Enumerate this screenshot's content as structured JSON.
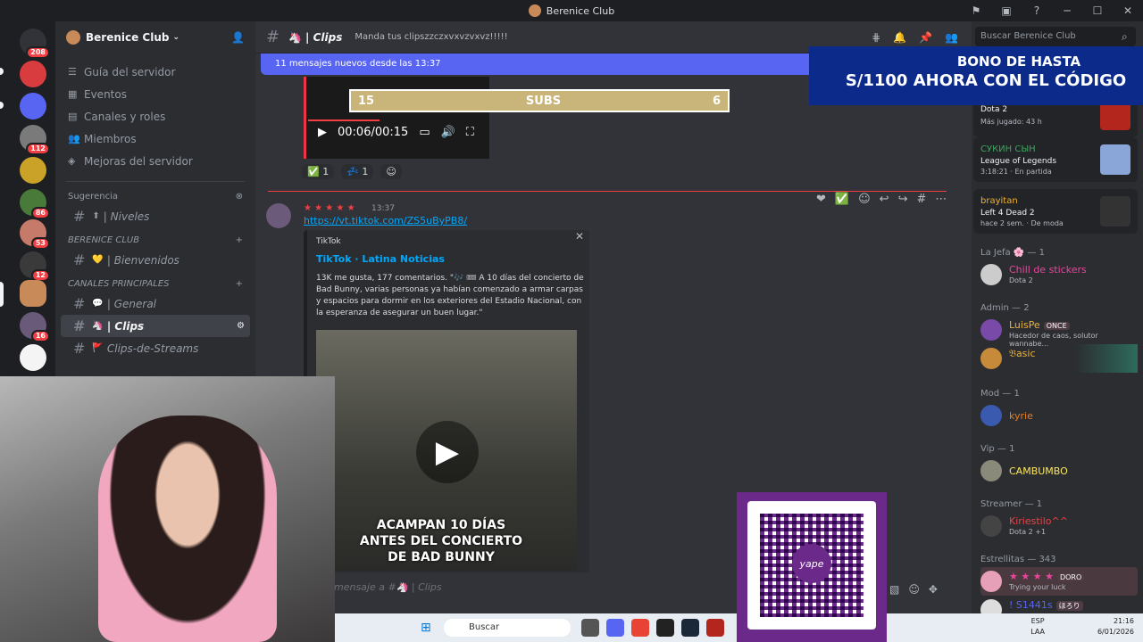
{
  "window": {
    "title": "Berenice Club"
  },
  "servers": {
    "badges": [
      "208",
      "112",
      "86",
      "53",
      "12",
      "16"
    ]
  },
  "sidebar": {
    "server_name": "Berenice Club",
    "nav": [
      {
        "icon": "list-icon",
        "label": "Guía del servidor"
      },
      {
        "icon": "calendar-icon",
        "label": "Eventos"
      },
      {
        "icon": "roles-icon",
        "label": "Canales y roles"
      },
      {
        "icon": "members-icon",
        "label": "Miembros"
      },
      {
        "icon": "boost-icon",
        "label": "Mejoras del servidor"
      }
    ],
    "suggestion_label": "Sugerencia",
    "suggestion_channel": "| Niveles",
    "cat1": "BERENICE CLUB",
    "cat1_channels": [
      "| Bienvenidos"
    ],
    "cat2": "CANALES PRINCIPALES",
    "cat2_channels": [
      "| General",
      "| Clips",
      "Clips-de-Streams"
    ]
  },
  "channel": {
    "name": "| Clips",
    "topic": "Manda tus clipszzczxvxvzvxvz!!!!!"
  },
  "banner": {
    "text": "11 mensajes nuevos desde las 13:37"
  },
  "video": {
    "time": "00:06/00:15",
    "overlay_left": "15",
    "overlay_mid": "SUBS",
    "overlay_right": "6"
  },
  "reactions": [
    {
      "emoji": "✅",
      "count": "1"
    },
    {
      "emoji": "💤",
      "count": "1"
    }
  ],
  "message": {
    "time": "13:37",
    "link": "https://vt.tiktok.com/ZS5uByPB8/"
  },
  "embed": {
    "provider": "TikTok",
    "title": "TikTok · Latina Noticias",
    "description": "13K me gusta, 177 comentarios. \"🎶 🎟 A 10 días del concierto de Bad Bunny, varias personas ya habían comenzado a armar carpas y espacios para dormir en los exteriores del Estadio Nacional, con la esperanza de asegurar un buen lugar.\"",
    "caption": "ACAMPAN 10 DÍAS ANTES DEL CONCIERTO DE BAD BUNNY"
  },
  "composer": {
    "placeholder": "mensaje a #🦄 | Clips"
  },
  "members": {
    "search_placeholder": "Buscar Berenice Club",
    "activities": [
      {
        "name": "",
        "game": "Dota 2",
        "sub": "Más jugado: 43 h"
      },
      {
        "name": "СУКИН СЫН",
        "game": "League of Legends",
        "sub": "3:18:21 · En partida"
      },
      {
        "name": "brayitan",
        "game": "Left 4 Dead 2",
        "sub": "hace 2 sem. · De moda"
      }
    ],
    "groups": [
      {
        "title": "La Jefa 🌸 — 1",
        "members": [
          {
            "name": "Chill de stickers",
            "status": "Dota 2",
            "color": "#eb459e"
          }
        ]
      },
      {
        "title": "Admin — 2",
        "members": [
          {
            "name": "LuisPe",
            "tag": "ONCE",
            "status": "Hacedor de caos, solutor wannabe...",
            "color": "#f0b232"
          },
          {
            "name": "𝔅asic",
            "status": "",
            "color": "#f0b232"
          }
        ]
      },
      {
        "title": "Mod — 1",
        "members": [
          {
            "name": "kyrie",
            "status": "",
            "color": "#e67e22"
          }
        ]
      },
      {
        "title": "Vip — 1",
        "members": [
          {
            "name": "CAMBUMBO",
            "status": "",
            "color": "#fee75c"
          }
        ]
      },
      {
        "title": "Streamer — 1",
        "members": [
          {
            "name": "Kiriestilo^^",
            "status": "Dota 2 +1",
            "color": "#f23f43"
          }
        ]
      },
      {
        "title": "Estrellitas — 343",
        "members": [
          {
            "name": "",
            "tag": "DORO",
            "status": "Trying your luck",
            "color": "#eb459e"
          },
          {
            "name": "! S1441s",
            "tag": "ほろり",
            "status": "",
            "color": "#5865f2"
          }
        ]
      }
    ]
  },
  "promo": {
    "line1": "BONO DE HASTA",
    "line2": "S/1100 AHORA CON EL CÓDIGO"
  },
  "qr": {
    "label": "yape"
  },
  "taskbar": {
    "search": "Buscar",
    "lang1": "ESP",
    "lang2": "LAA",
    "time": "21:16",
    "date": "6/01/2026"
  }
}
